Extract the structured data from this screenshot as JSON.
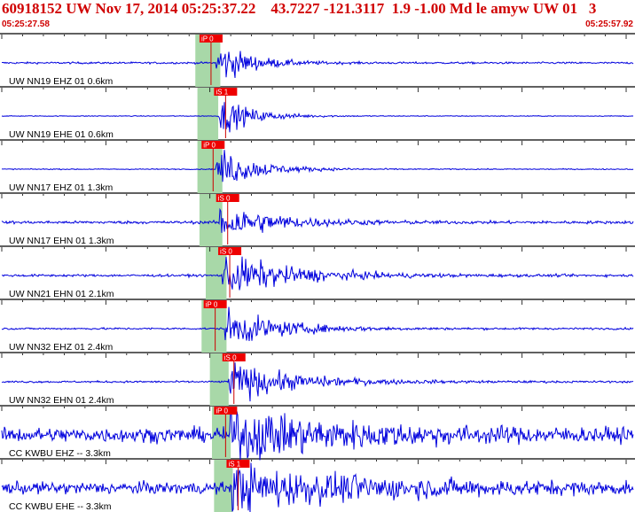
{
  "header": {
    "title": "60918152 UW Nov 17, 2014 05:25:37.22    43.7227 -121.3117  1.9 -1.00 Md le amyw UW 01   3",
    "start_time": "05:25:27.58",
    "end_time": "05:25:57.92"
  },
  "colors": {
    "trace": "#0000dd",
    "header_text": "#d00000",
    "pick_box": "#ee0000",
    "pick_text": "#ffffff",
    "pick_line": "#cc0000",
    "window": "#a8d8a8",
    "separator": "#000000",
    "tick": "#000000"
  },
  "chart_data": {
    "type": "line",
    "x_range": [
      "05:25:27.58",
      "05:25:57.92"
    ],
    "channels": [
      {
        "label": "UW NN19 EHZ 01 0.6km",
        "pick": "iP 0",
        "pick_time": 9.5,
        "window": [
          9.3,
          10.5
        ],
        "arrival": 10.3,
        "noise": 0.04,
        "amp": 0.95,
        "decay": 1.5
      },
      {
        "label": "UW NN19 EHE 01 0.6km",
        "pick": "iS 1",
        "pick_time": 10.2,
        "window": [
          9.4,
          10.4
        ],
        "arrival": 10.4,
        "noise": 0.015,
        "amp": 0.8,
        "decay": 1.6
      },
      {
        "label": "UW NN17 EHZ 01 1.3km",
        "pick": "iP 0",
        "pick_time": 9.6,
        "window": [
          9.4,
          10.6
        ],
        "arrival": 10.3,
        "noise": 0.02,
        "amp": 0.95,
        "decay": 1.8
      },
      {
        "label": "UW NN17 EHN 01 1.3km",
        "pick": "iS 0",
        "pick_time": 10.3,
        "window": [
          9.5,
          10.6
        ],
        "arrival": 10.4,
        "noise": 0.06,
        "amp": 0.85,
        "decay": 2.5
      },
      {
        "label": "UW NN21 EHN 01 2.1km",
        "pick": "iS 0",
        "pick_time": 10.4,
        "window": [
          9.8,
          10.8
        ],
        "arrival": 10.6,
        "noise": 0.05,
        "amp": 0.9,
        "decay": 3.2
      },
      {
        "label": "UW NN32 EHZ 01 2.4km",
        "pick": "iP 0",
        "pick_time": 9.7,
        "window": [
          9.6,
          10.8
        ],
        "arrival": 10.7,
        "noise": 0.04,
        "amp": 0.85,
        "decay": 2.5
      },
      {
        "label": "UW NN32 EHN 01 2.4km",
        "pick": "iS 0",
        "pick_time": 10.6,
        "window": [
          10.0,
          10.9
        ],
        "arrival": 10.9,
        "noise": 0.04,
        "amp": 0.85,
        "decay": 3.0
      },
      {
        "label": "CC KWBU EHZ -- 3.3km",
        "pick": "iP 0",
        "pick_time": 10.2,
        "window": [
          10.1,
          11.0
        ],
        "arrival": 10.9,
        "noise": 0.3,
        "amp": 1.0,
        "decay": 5.0
      },
      {
        "label": "CC KWBU EHE -- 3.3km",
        "pick": "iS 1",
        "pick_time": 10.8,
        "window": [
          10.2,
          11.1
        ],
        "arrival": 11.0,
        "noise": 0.25,
        "amp": 0.85,
        "decay": 6.0
      }
    ]
  }
}
